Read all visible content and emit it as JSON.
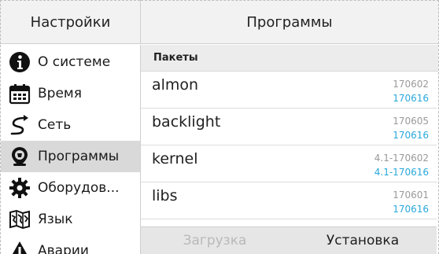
{
  "header": {
    "left_title": "Настройки",
    "right_title": "Программы"
  },
  "sidebar": {
    "items": [
      {
        "label": "О системе",
        "icon": "info-icon"
      },
      {
        "label": "Время",
        "icon": "calendar-icon"
      },
      {
        "label": "Сеть",
        "icon": "network-path-icon"
      },
      {
        "label": "Программы",
        "icon": "software-pin-icon",
        "active": true
      },
      {
        "label": "Оборудов...",
        "icon": "gear-icon"
      },
      {
        "label": "Язык",
        "icon": "map-icon"
      },
      {
        "label": "Аварии",
        "icon": "warning-icon"
      }
    ]
  },
  "content": {
    "section_title": "Пакеты",
    "packages": [
      {
        "name": "almon",
        "current": "170602",
        "available": "170616"
      },
      {
        "name": "backlight",
        "current": "170605",
        "available": "170616"
      },
      {
        "name": "kernel",
        "current": "4.1-170602",
        "available": "4.1-170616"
      },
      {
        "name": "libs",
        "current": "170601",
        "available": "170616"
      }
    ]
  },
  "buttons": {
    "download": "Загрузка",
    "install": "Установка"
  },
  "colors": {
    "accent": "#2aa8db",
    "active_bg": "#d9d9d9",
    "header_bg": "#f2f2f2"
  }
}
